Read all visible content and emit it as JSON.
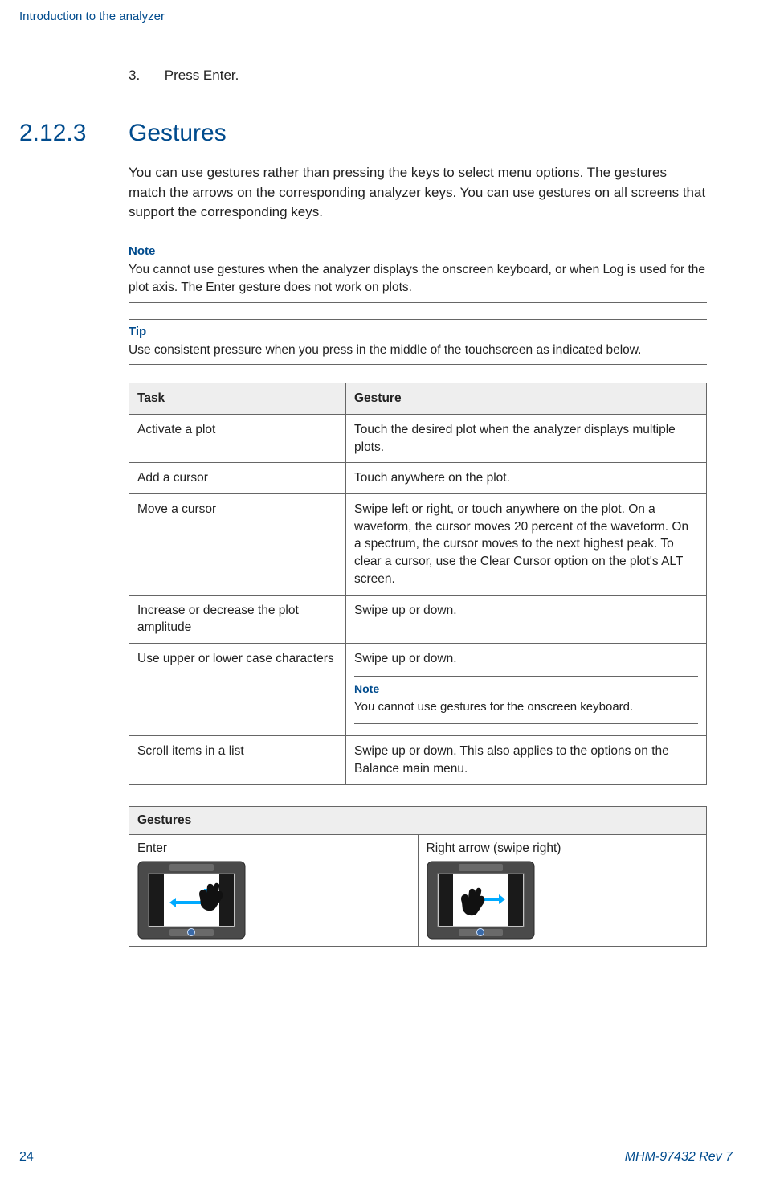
{
  "header": {
    "running": "Introduction to the analyzer"
  },
  "step": {
    "num": "3.",
    "text_a": "Press ",
    "text_b": "Enter",
    "text_c": "."
  },
  "section": {
    "num": "2.12.3",
    "title": "Gestures"
  },
  "intro": "You can use gestures rather than pressing the keys to select menu options. The gestures match the arrows on the corresponding analyzer keys. You can use gestures on all screens that support the corresponding keys.",
  "note": {
    "label": "Note",
    "body": "You cannot use gestures when the analyzer displays the onscreen keyboard, or when Log is used for the plot axis. The Enter gesture does not work on plots."
  },
  "tip": {
    "label": "Tip",
    "body": "Use consistent pressure when you press in the middle of the touchscreen as indicated below."
  },
  "table1": {
    "head": {
      "c1": "Task",
      "c2": "Gesture"
    },
    "rows": [
      {
        "c1": "Activate a plot",
        "c2": "Touch the desired plot when the analyzer displays multiple plots."
      },
      {
        "c1": "Add a cursor",
        "c2": "Touch anywhere on the plot."
      },
      {
        "c1": "Move a cursor",
        "c2_a": "Swipe left or right, or touch anywhere on the plot. On a waveform, the cursor moves 20 percent of the waveform. On a spectrum, the cursor moves to the next highest peak. To clear a cursor, use the ",
        "c2_b": "Clear Cursor",
        "c2_c": " option on the plot's ALT screen."
      },
      {
        "c1": "Increase or decrease the plot amplitude",
        "c2": "Swipe up or down."
      },
      {
        "c1": "Use upper or lower case characters",
        "c2": "Swipe up or down.",
        "note_label": "Note",
        "note_body": "You cannot use gestures for the onscreen keyboard."
      },
      {
        "c1": "Scroll items in a list",
        "c2": "Swipe up or down. This also applies to the options on the Balance main menu."
      }
    ]
  },
  "table2": {
    "head": "Gestures",
    "cells": [
      {
        "label": "Enter"
      },
      {
        "label": "Right arrow (swipe right)"
      }
    ]
  },
  "footer": {
    "page": "24",
    "rev": "MHM-97432 Rev 7"
  }
}
